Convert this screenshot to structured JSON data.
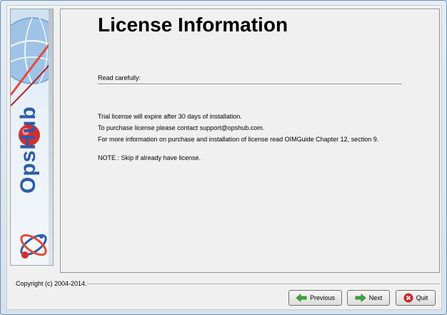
{
  "page": {
    "title": "License Information",
    "subheading": "Read carefully:",
    "lines": [
      "Trial license will expire after 30 days of installation.",
      "To purchase license please contact support@opshub.com.",
      "For more information on purchase and installation of license read OIMGuide Chapter 12, section 9."
    ],
    "note": "NOTE : Skip if already have license."
  },
  "banner": {
    "brand": "OpsHub"
  },
  "footer": {
    "copyright": "Copyright (c) 2004-2014.",
    "previous_label": "Previous",
    "next_label": "Next",
    "quit_label": "Quit"
  },
  "icons": {
    "previous": "arrow-left-icon",
    "next": "arrow-right-icon",
    "quit": "close-circle-icon"
  },
  "colors": {
    "brand": "#2d5aa8",
    "arrow_green": "#3fa83a",
    "quit_red": "#d42a2a"
  }
}
